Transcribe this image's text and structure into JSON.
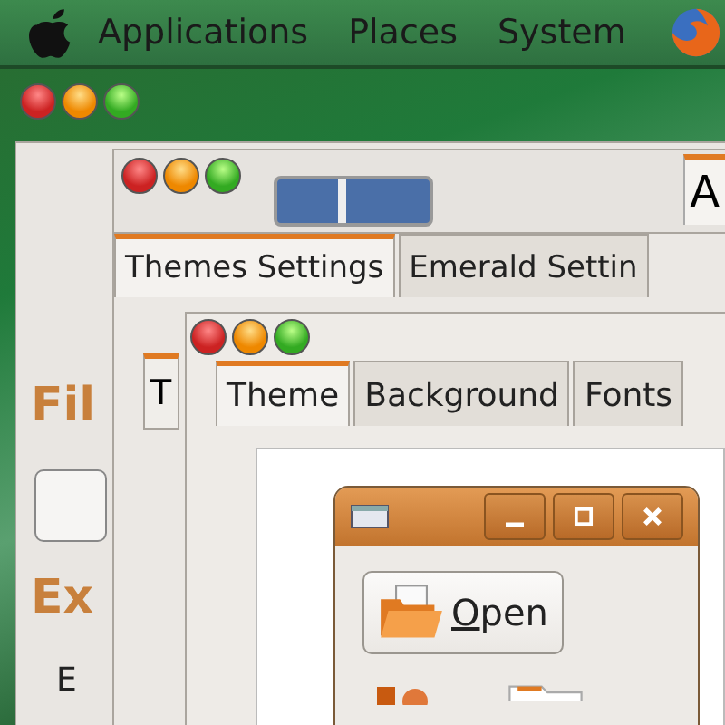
{
  "panel": {
    "menus": [
      "Applications",
      "Places",
      "System"
    ]
  },
  "back_window": {
    "tab": "A",
    "labels": [
      "Fil",
      "Ex",
      "E"
    ]
  },
  "themes_window": {
    "tabs": [
      {
        "label": "Themes Settings",
        "selected": true
      },
      {
        "label": "Emerald Settin",
        "selected": false
      }
    ],
    "inner_tab": "T"
  },
  "theme_dialog": {
    "tabs": [
      {
        "label": "Theme",
        "selected": true
      },
      {
        "label": "Background",
        "selected": false
      },
      {
        "label": "Fonts",
        "selected": false
      }
    ],
    "preview": {
      "button": "Open"
    }
  }
}
